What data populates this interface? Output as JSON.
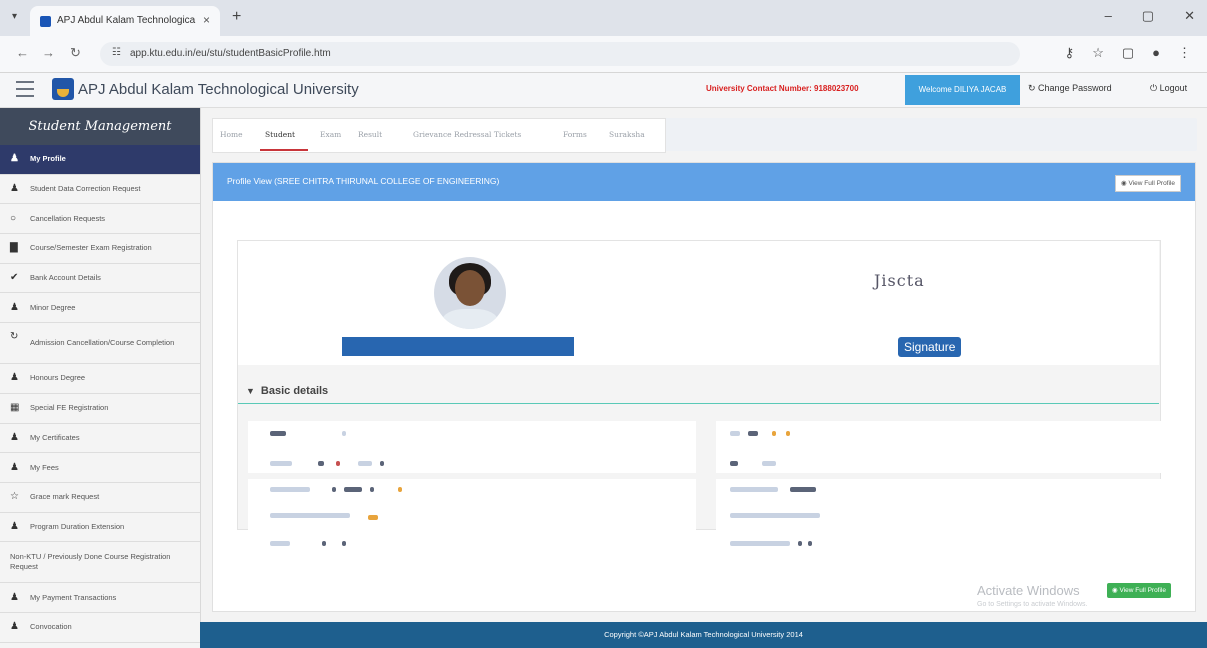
{
  "browser": {
    "tab_title": "APJ Abdul Kalam Technologica",
    "url": "app.ktu.edu.in/eu/stu/studentBasicProfile.htm",
    "new_tab": "+",
    "close": "×"
  },
  "header": {
    "university_name": "APJ Abdul Kalam Technological University",
    "contact": "University Contact Number: 9188023700",
    "welcome": "Welcome DILIYA JACAB",
    "change_password": "Change Password",
    "logout": "Logout"
  },
  "sidebar": {
    "title": "Student Management",
    "items": [
      {
        "label": "My Profile",
        "icon": "user-icon",
        "active": true
      },
      {
        "label": "Student Data Correction Request",
        "icon": "user-icon"
      },
      {
        "label": "Cancellation Requests",
        "icon": "circle-icon"
      },
      {
        "label": "Course/Semester Exam Registration",
        "icon": "book-icon"
      },
      {
        "label": "Bank Account Details",
        "icon": "check-icon"
      },
      {
        "label": "Minor Degree",
        "icon": "user-icon"
      },
      {
        "label": "Admission Cancellation/Course Completion",
        "icon": "refresh-icon"
      },
      {
        "label": "Honours Degree",
        "icon": "user-icon"
      },
      {
        "label": "Special FE Registration",
        "icon": "grid-icon"
      },
      {
        "label": "My Certificates",
        "icon": "user-icon"
      },
      {
        "label": "My Fees",
        "icon": "user-icon"
      },
      {
        "label": "Grace mark Request",
        "icon": "star-icon"
      },
      {
        "label": "Program Duration Extension",
        "icon": "user-icon"
      },
      {
        "label": "Non-KTU / Previously Done Course Registration Request",
        "icon": "none"
      },
      {
        "label": "My Payment Transactions",
        "icon": "user-icon"
      },
      {
        "label": "Convocation",
        "icon": "user-icon"
      }
    ]
  },
  "top_tabs": [
    {
      "label": "Home"
    },
    {
      "label": "Student",
      "active": true
    },
    {
      "label": "Exam"
    },
    {
      "label": "Result"
    },
    {
      "label": "Grievance Redressal Tickets"
    },
    {
      "label": "Forms"
    },
    {
      "label": "Suraksha"
    }
  ],
  "panel": {
    "title": "Profile View (SREE CHITRA THIRUNAL COLLEGE OF ENGINEERING)",
    "view_full_profile": "View Full Profile",
    "signature_image_text": "Jiscta",
    "signature_label": "Signature",
    "basic_details": "Basic details"
  },
  "watermark": {
    "title": "Activate Windows",
    "subtitle": "Go to Settings to activate Windows."
  },
  "footer": {
    "copyright": "Copyright ©APJ Abdul Kalam Technological University 2014"
  },
  "colors": {
    "sidebar_active": "#2e3a6a",
    "panel_header": "#60a1e6",
    "footer": "#1e5f8e",
    "contact_red": "#d81f1f",
    "welcome_blue": "#3fa0dd"
  }
}
